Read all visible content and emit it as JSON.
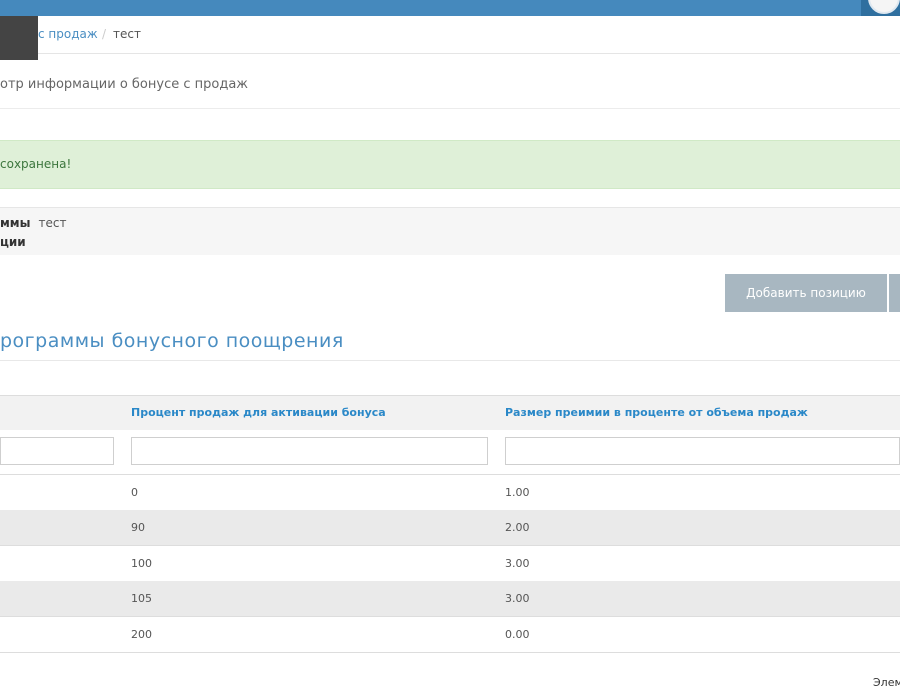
{
  "breadcrumb": {
    "link": "с продаж",
    "separator": "/",
    "current": "тест"
  },
  "page_title": "отр информации о бонусе с продаж",
  "alert": {
    "text": "сохранена!"
  },
  "info": {
    "row1_label": "ммы",
    "row1_value": "тест",
    "row2_label": "ции"
  },
  "actions": {
    "add_position": "Добавить позицию"
  },
  "section_title": "рограммы бонусного поощрения",
  "table": {
    "columns": [
      "Процент продаж для активации бонуса",
      "Размер преимии в проценте от объема продаж"
    ],
    "rows": [
      {
        "percent": "0",
        "bonus": "1.00"
      },
      {
        "percent": "90",
        "bonus": "2.00"
      },
      {
        "percent": "100",
        "bonus": "3.00"
      },
      {
        "percent": "105",
        "bonus": "3.00"
      },
      {
        "percent": "200",
        "bonus": "0.00"
      }
    ]
  },
  "footer": {
    "text": "Элем"
  },
  "colors": {
    "topbar": "#4589bd",
    "accent": "#4a8ec2",
    "success_bg": "#dff0d8",
    "button": "#a8b7c1"
  }
}
